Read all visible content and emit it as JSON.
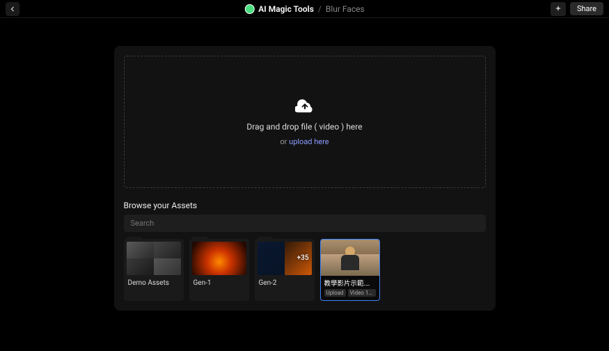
{
  "header": {
    "home": "AI Magic Tools",
    "separator": "/",
    "page": "Blur Faces",
    "share": "Share"
  },
  "dropzone": {
    "main": "Drag and drop file ( video ) here",
    "or": "or ",
    "link": "upload here"
  },
  "browse": {
    "label": "Browse your Assets",
    "placeholder": "Search"
  },
  "folders": [
    {
      "name": "Demo Assets",
      "style": "grid",
      "badge": ""
    },
    {
      "name": "Gen-1",
      "style": "fire",
      "badge": ""
    },
    {
      "name": "Gen-2",
      "style": "blue",
      "badge": "+35"
    }
  ],
  "video": {
    "name": "教學影片示範.mov",
    "tag1": "Upload",
    "tag2": "Video 1…"
  }
}
